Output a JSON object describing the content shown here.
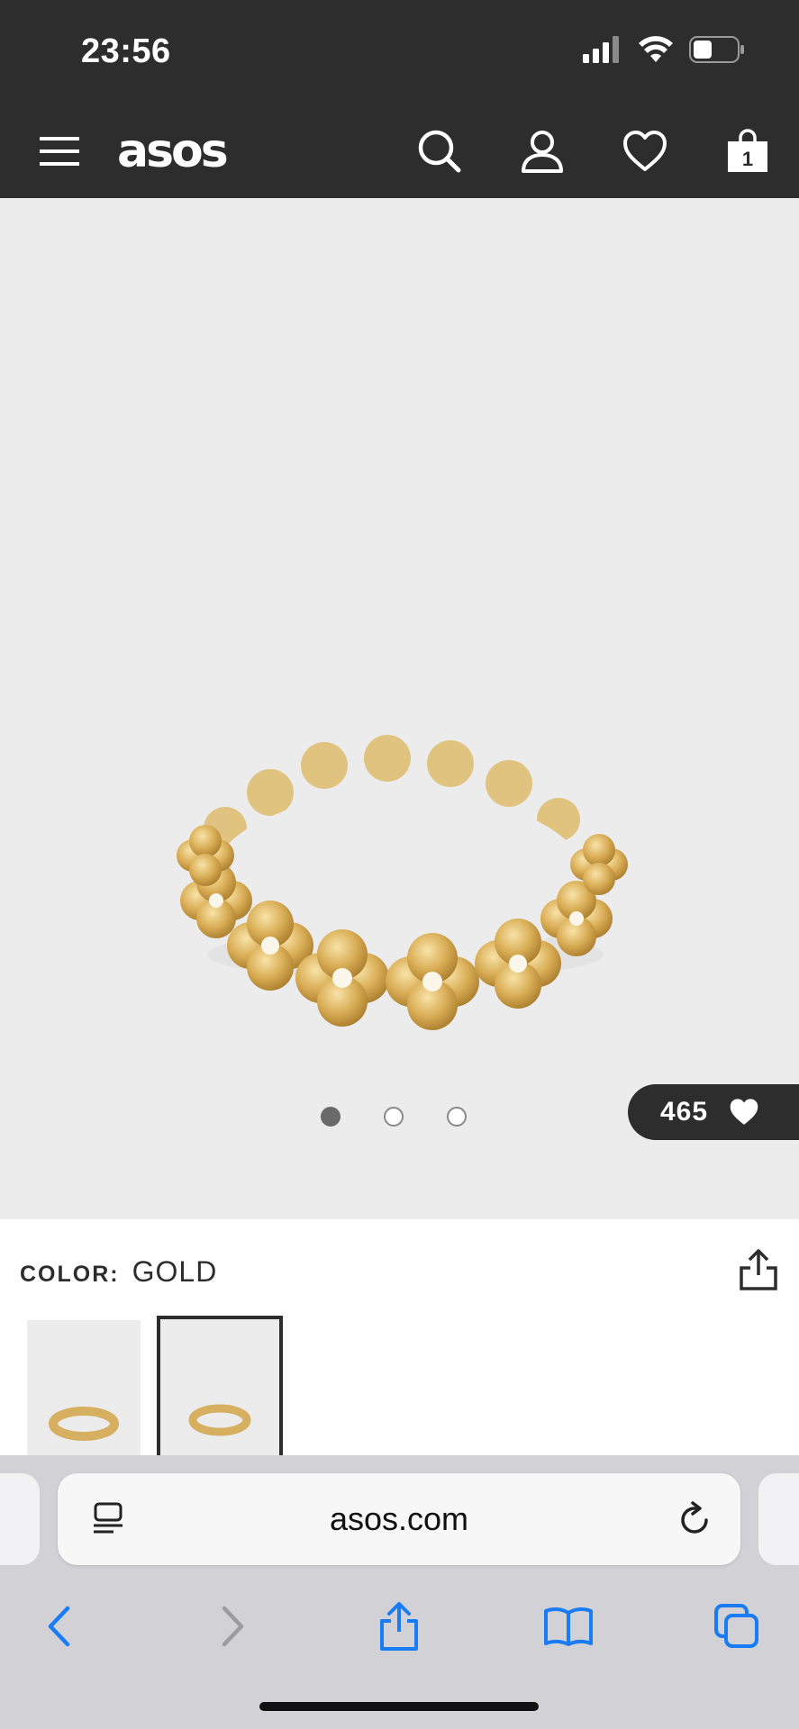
{
  "status_bar": {
    "time": "23:56"
  },
  "header": {
    "logo": "asos",
    "bag_count": "1",
    "icons": [
      "menu-icon",
      "search-icon",
      "account-icon",
      "heart-icon",
      "bag-icon"
    ]
  },
  "product": {
    "saves_count": "465",
    "image_count": 3,
    "active_image": 1,
    "color_label": "COLOR:",
    "color_value": "GOLD",
    "thumbnails": 2,
    "selected_thumbnail": 2
  },
  "browser": {
    "url": "asos.com",
    "icons": [
      "reader-icon",
      "reload-icon",
      "back-icon",
      "forward-icon",
      "share-icon",
      "bookmarks-icon",
      "tabs-icon"
    ]
  },
  "colors": {
    "dark": "#2d2d2d",
    "safari_blue": "#1a7cf5",
    "hero_bg": "#ececec"
  }
}
